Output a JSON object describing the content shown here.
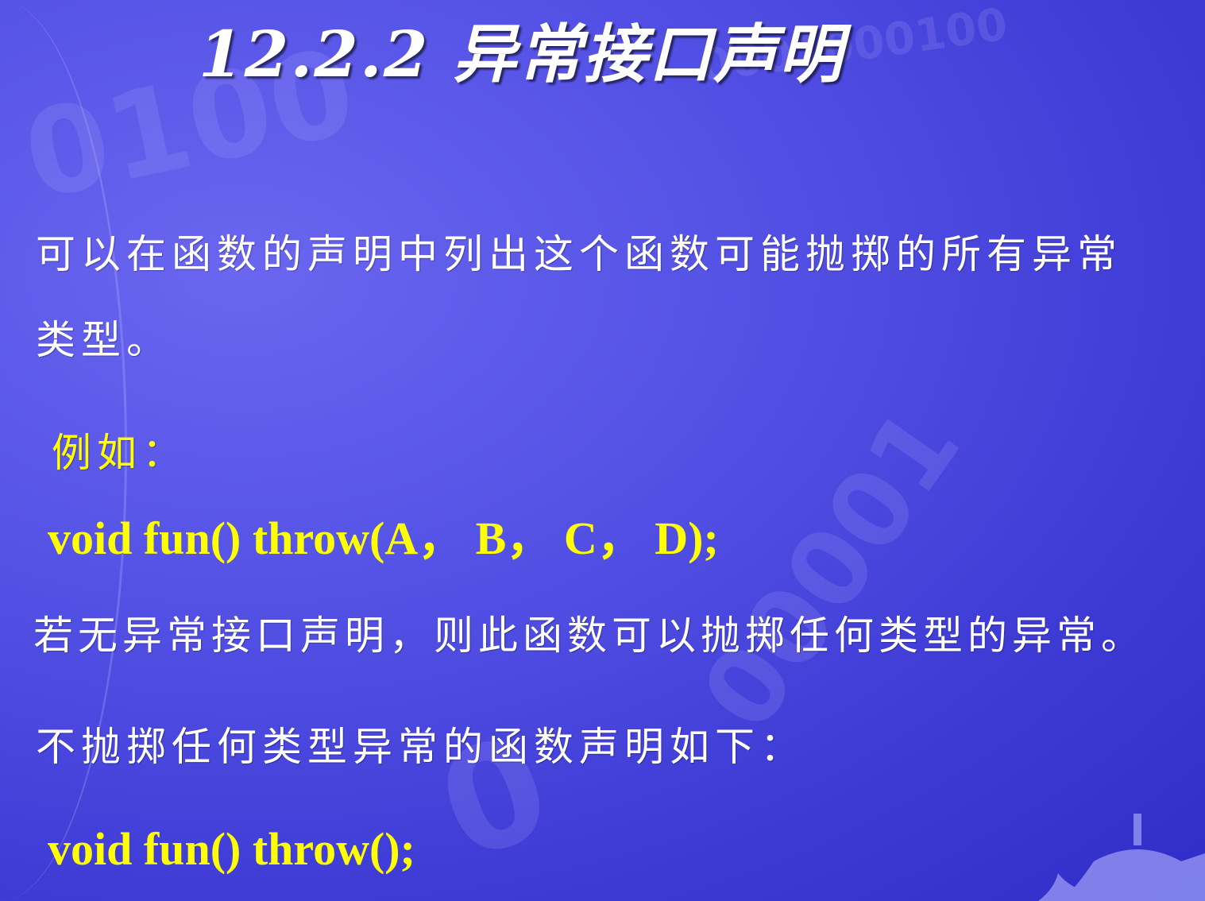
{
  "slide": {
    "title": "12.2.2 异常接口声明",
    "paragraph1_line1": "可以在函数的声明中列出这个函数可能抛掷的所有异常",
    "paragraph1_line2": "类型。",
    "example_label": "例如：",
    "code1": "void fun() throw(A， B， C， D);",
    "paragraph2": "若无异常接口声明，则此函数可以抛掷任何类型的异常。",
    "paragraph3": "不抛掷任何类型异常的函数声明如下：",
    "code2": "void fun() throw();"
  },
  "colors": {
    "background": "#4a48e0",
    "body_text": "#ffffff",
    "highlight_text": "#ffff00"
  },
  "decorations": {
    "binary_watermark": "0100010001000100"
  }
}
